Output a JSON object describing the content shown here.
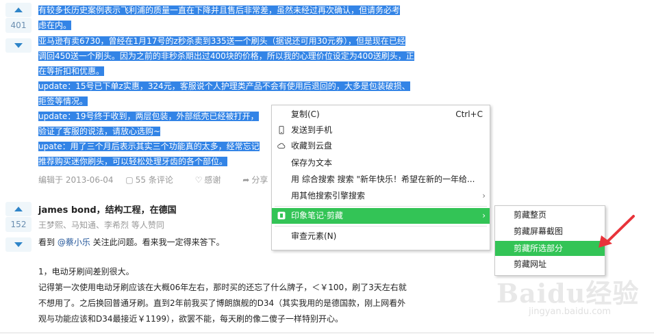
{
  "answer1": {
    "votes": "401",
    "lines": [
      "有较多长历史案例表示飞利浦的质量一直在下降并且售后非常差，虽然未经过再次确认，但请务必考",
      "虑在内。",
      "亚马逊有卖6730，曾经在1月17号的z秒杀卖到335送一个刷头（据说还可用30元券），但是现在已经",
      "调回450送一个刷头。因为之前的非秒杀期出过400块的价格，所以我的心理价位设定为400送刷头，正",
      "在等折扣和优惠。",
      "update：15号已下单z实惠，324元，客服说个人护理类产品不会有使用后退回的，大多是包装破损、",
      "拒签等情况。",
      "update：19号终于收到，两层包装，外部纸壳已经被打开，",
      "验证了客服的说法，请放心选购~",
      "upate：用了三个月后表示其实三个功能真的太多，经常忘记",
      "推荐购买迷你刷头，可以轻松处理牙齿的各个部位。"
    ],
    "meta": {
      "edited": "编辑于 2013-06-04",
      "comments": "55 条评论",
      "thanks": "感谢",
      "share": "分享",
      "collect": "收藏"
    }
  },
  "answer2": {
    "votes": "152",
    "author": "james bond，结构工程，在德国",
    "voters": "王梦熙、马知通、李希烈 等人赞同",
    "lines": {
      "l1a": "看到 ",
      "l1link": "@蔡小乐",
      "l1b": " 关注此问题。看来我一定得来答下。",
      "l2": "1，电动牙刷间差别很大。",
      "l3": "记得第一次使用电动牙刷应该在大概06年左右，那时买的还忘了什么牌子，＜￥100，刷了3天左右就",
      "l4": "不想用了。之后换回普通牙刷。直到2年前我买了博朗旗舰的D34（其实我用的是德国款，刚上网看外",
      "l5": "观与功能应该和D34最接近￥1199），欲罢不能，每天刷的像二傻子一样特别开心。"
    }
  },
  "context_menu": {
    "items": [
      {
        "label": "复制(C)",
        "shortcut": "Ctrl+C"
      },
      {
        "label": "发送到手机"
      },
      {
        "label": "收藏到云盘"
      },
      {
        "label": "保存为文本"
      },
      {
        "label": "用 综合搜索 搜索 \"新年快乐！希望在新的一年给..."
      },
      {
        "label": "用其他搜索引擎搜索"
      },
      {
        "label": "印象笔记·剪藏"
      },
      {
        "label": "审查元素(N)"
      }
    ]
  },
  "submenu": {
    "items": [
      "剪藏整页",
      "剪藏屏幕截图",
      "剪藏所选部分",
      "剪藏网址"
    ]
  },
  "watermark": {
    "brand": "Baidu经验",
    "url": "jingyan.baidu.com"
  },
  "colors": {
    "selection": "#3384e6",
    "highlight": "#33c456",
    "arrow": "#e8333a"
  }
}
